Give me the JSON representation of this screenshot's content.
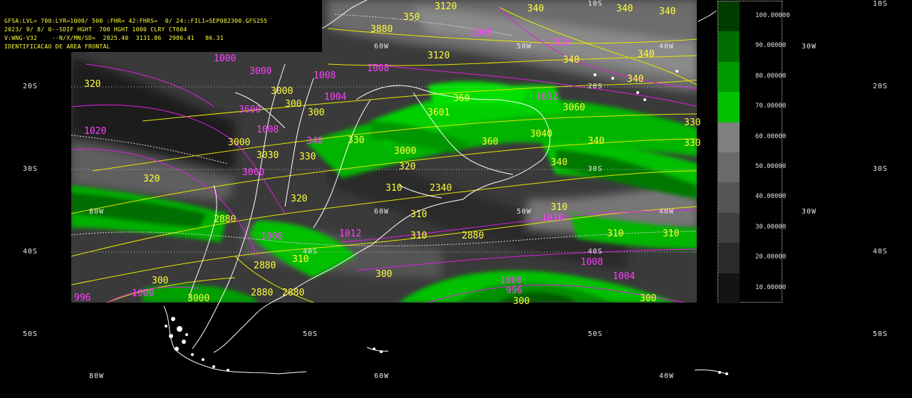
{
  "header": {
    "line1": "GFSA:LVL= 700:LYR=1000/ 500 :FHR= 42:FHRS=  0/ 24::FIL1=SEP082300.GFS255",
    "line2": "2023/ 9/ 8/ 0--SDIF HGHT  700 HGHT 1000 CLRY CT604",
    "line3": "V:WNG-V32    --N/X/MN/SD=  2825.40  3131.86  2986.41   86.31",
    "line4": "IDENTIFICACAO DE AREA FRONTAL"
  },
  "colors": {
    "thickness_contour": "#ffff00",
    "pressure_contour": "#ff30ff",
    "coastline": "#ffffff",
    "green_low": "#00c800",
    "green_mid": "#009600",
    "green_high": "#005a00"
  },
  "latitudes": [
    "10S",
    "20S",
    "30S",
    "40S",
    "50S"
  ],
  "longitudes": [
    "80W",
    "60W",
    "50W",
    "40W",
    "30W"
  ],
  "legend": {
    "values": [
      "100.00000",
      "90.00000",
      "80.00000",
      "70.00000",
      "60.00000",
      "50.00000",
      "40.00000",
      "30.00000",
      "20.00000",
      "10.00000"
    ],
    "colors": [
      "#003c00",
      "#006e00",
      "#009a00",
      "#00c000",
      "#808080",
      "#6a6a6a",
      "#555555",
      "#404040",
      "#2a2a2a",
      "#141414"
    ]
  },
  "contour_labels": {
    "thickness": [
      "350",
      "3120",
      "340",
      "3880",
      "3120",
      "340",
      "320",
      "360",
      "3060",
      "330",
      "340",
      "3080",
      "310",
      "2340",
      "320",
      "310",
      "2880",
      "300",
      "3040",
      "300",
      "330",
      "3000"
    ],
    "pressure": [
      "1020",
      "1012",
      "1016",
      "1008",
      "1004",
      "996",
      "1000"
    ]
  }
}
